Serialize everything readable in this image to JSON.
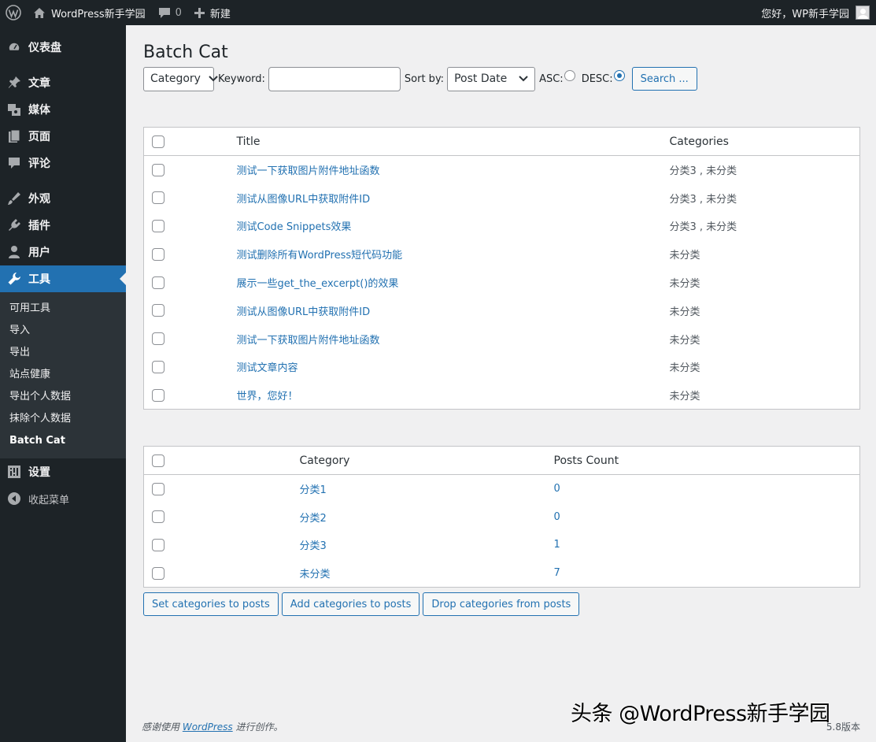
{
  "adminbar": {
    "site_name": "WordPress新手学园",
    "comment_count": "0",
    "new_label": "新建",
    "greeting": "您好，WP新手学园"
  },
  "sidebar": {
    "items": [
      {
        "label": "仪表盘",
        "icon": "dashboard-icon"
      },
      {
        "label": "文章",
        "icon": "pin-icon"
      },
      {
        "label": "媒体",
        "icon": "media-icon"
      },
      {
        "label": "页面",
        "icon": "page-icon"
      },
      {
        "label": "评论",
        "icon": "comment-icon"
      },
      {
        "label": "外观",
        "icon": "appearance-icon"
      },
      {
        "label": "插件",
        "icon": "plugin-icon"
      },
      {
        "label": "用户",
        "icon": "user-icon"
      },
      {
        "label": "工具",
        "icon": "wrench-icon"
      },
      {
        "label": "设置",
        "icon": "settings-icon"
      },
      {
        "label": "收起菜单",
        "icon": "collapse-icon"
      }
    ],
    "submenu": [
      "可用工具",
      "导入",
      "导出",
      "站点健康",
      "导出个人数据",
      "抹除个人数据",
      "Batch Cat"
    ]
  },
  "page": {
    "title": "Batch Cat"
  },
  "filters": {
    "category_select": "Category",
    "keyword_label": "Keyword:",
    "keyword_value": "",
    "sortby_label": "Sort by:",
    "sortby_select": "Post Date",
    "asc_label": "ASC:",
    "desc_label": "DESC:",
    "selected_order": "DESC",
    "search_button": "Search ..."
  },
  "posts_table": {
    "headers": {
      "title": "Title",
      "categories": "Categories"
    },
    "rows": [
      {
        "title": "测试一下获取图片附件地址函数",
        "categories": "分类3 , 未分类"
      },
      {
        "title": "测试从图像URL中获取附件ID",
        "categories": "分类3 , 未分类"
      },
      {
        "title": "测试Code Snippets效果",
        "categories": "分类3 , 未分类"
      },
      {
        "title": "测试删除所有WordPress短代码功能",
        "categories": "未分类"
      },
      {
        "title": "展示一些get_the_excerpt()的效果",
        "categories": "未分类"
      },
      {
        "title": "测试从图像URL中获取附件ID",
        "categories": "未分类"
      },
      {
        "title": "测试一下获取图片附件地址函数",
        "categories": "未分类"
      },
      {
        "title": "测试文章内容",
        "categories": "未分类"
      },
      {
        "title": "世界，您好！",
        "categories": "未分类"
      }
    ]
  },
  "categories_table": {
    "headers": {
      "category": "Category",
      "count": "Posts Count"
    },
    "rows": [
      {
        "name": "分类1",
        "count": "0"
      },
      {
        "name": "分类2",
        "count": "0"
      },
      {
        "name": "分类3",
        "count": "1"
      },
      {
        "name": "未分类",
        "count": "7"
      }
    ]
  },
  "actions": {
    "set": "Set categories to posts",
    "add": "Add categories to posts",
    "drop": "Drop categories from posts"
  },
  "footer": {
    "thanks_prefix": "感谢使用",
    "link": "WordPress",
    "thanks_suffix": "进行创作。",
    "version": "5.8版本",
    "watermark": "头条 @WordPress新手学园"
  }
}
